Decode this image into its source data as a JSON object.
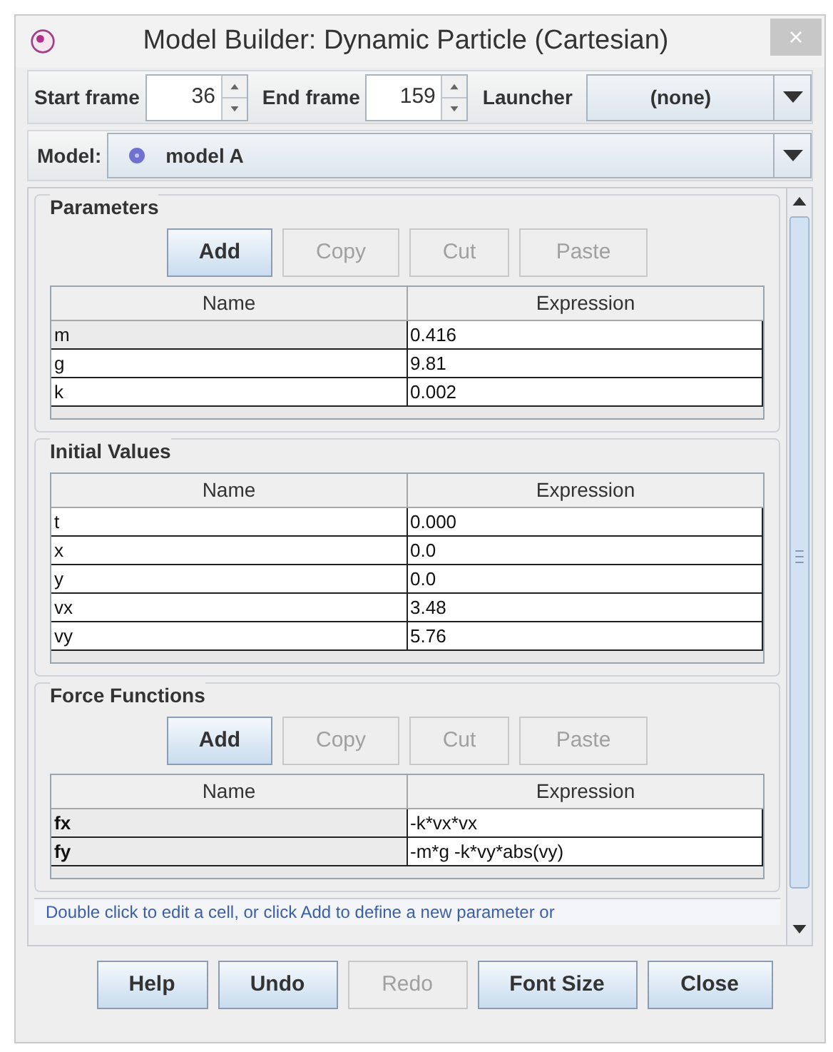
{
  "window": {
    "title": "Model Builder: Dynamic Particle (Cartesian)",
    "close": "×"
  },
  "toolbar": {
    "start_frame": {
      "label": "Start frame",
      "value": "36"
    },
    "end_frame": {
      "label": "End frame",
      "value": "159"
    },
    "launcher": {
      "label": "Launcher",
      "value": "(none)"
    }
  },
  "model": {
    "label": "Model:",
    "value": "model A"
  },
  "sections": [
    {
      "title": "Parameters",
      "buttons": [
        {
          "label": "Add",
          "disabled": false
        },
        {
          "label": "Copy",
          "disabled": true
        },
        {
          "label": "Cut",
          "disabled": true
        },
        {
          "label": "Paste",
          "disabled": true
        }
      ],
      "columns": [
        "Name",
        "Expression"
      ],
      "rows": [
        {
          "name": "m",
          "expression": "0.416",
          "shaded": true,
          "bold": false
        },
        {
          "name": "g",
          "expression": "9.81",
          "shaded": false,
          "bold": false
        },
        {
          "name": "k",
          "expression": "0.002",
          "shaded": false,
          "bold": false
        }
      ]
    },
    {
      "title": "Initial Values",
      "columns": [
        "Name",
        "Expression"
      ],
      "rows": [
        {
          "name": "t",
          "expression": "0.000",
          "shaded": false,
          "bold": false
        },
        {
          "name": "x",
          "expression": "0.0",
          "shaded": false,
          "bold": false
        },
        {
          "name": "y",
          "expression": "0.0",
          "shaded": false,
          "bold": false
        },
        {
          "name": "vx",
          "expression": "3.48",
          "shaded": false,
          "bold": false
        },
        {
          "name": "vy",
          "expression": "5.76",
          "shaded": false,
          "bold": false
        }
      ]
    },
    {
      "title": "Force Functions",
      "buttons": [
        {
          "label": "Add",
          "disabled": false
        },
        {
          "label": "Copy",
          "disabled": true
        },
        {
          "label": "Cut",
          "disabled": true
        },
        {
          "label": "Paste",
          "disabled": true
        }
      ],
      "columns": [
        "Name",
        "Expression"
      ],
      "rows": [
        {
          "name": "fx",
          "expression": "-k*vx*vx",
          "shaded": true,
          "bold": true
        },
        {
          "name": "fy",
          "expression": "-m*g -k*vy*abs(vy)",
          "shaded": true,
          "bold": true
        }
      ]
    }
  ],
  "hint": "Double click to edit a cell, or click Add to define a new parameter or",
  "buttons": [
    {
      "label": "Help",
      "disabled": false
    },
    {
      "label": "Undo",
      "disabled": false
    },
    {
      "label": "Redo",
      "disabled": true
    },
    {
      "label": "Font Size",
      "disabled": false
    },
    {
      "label": "Close",
      "disabled": false
    }
  ]
}
